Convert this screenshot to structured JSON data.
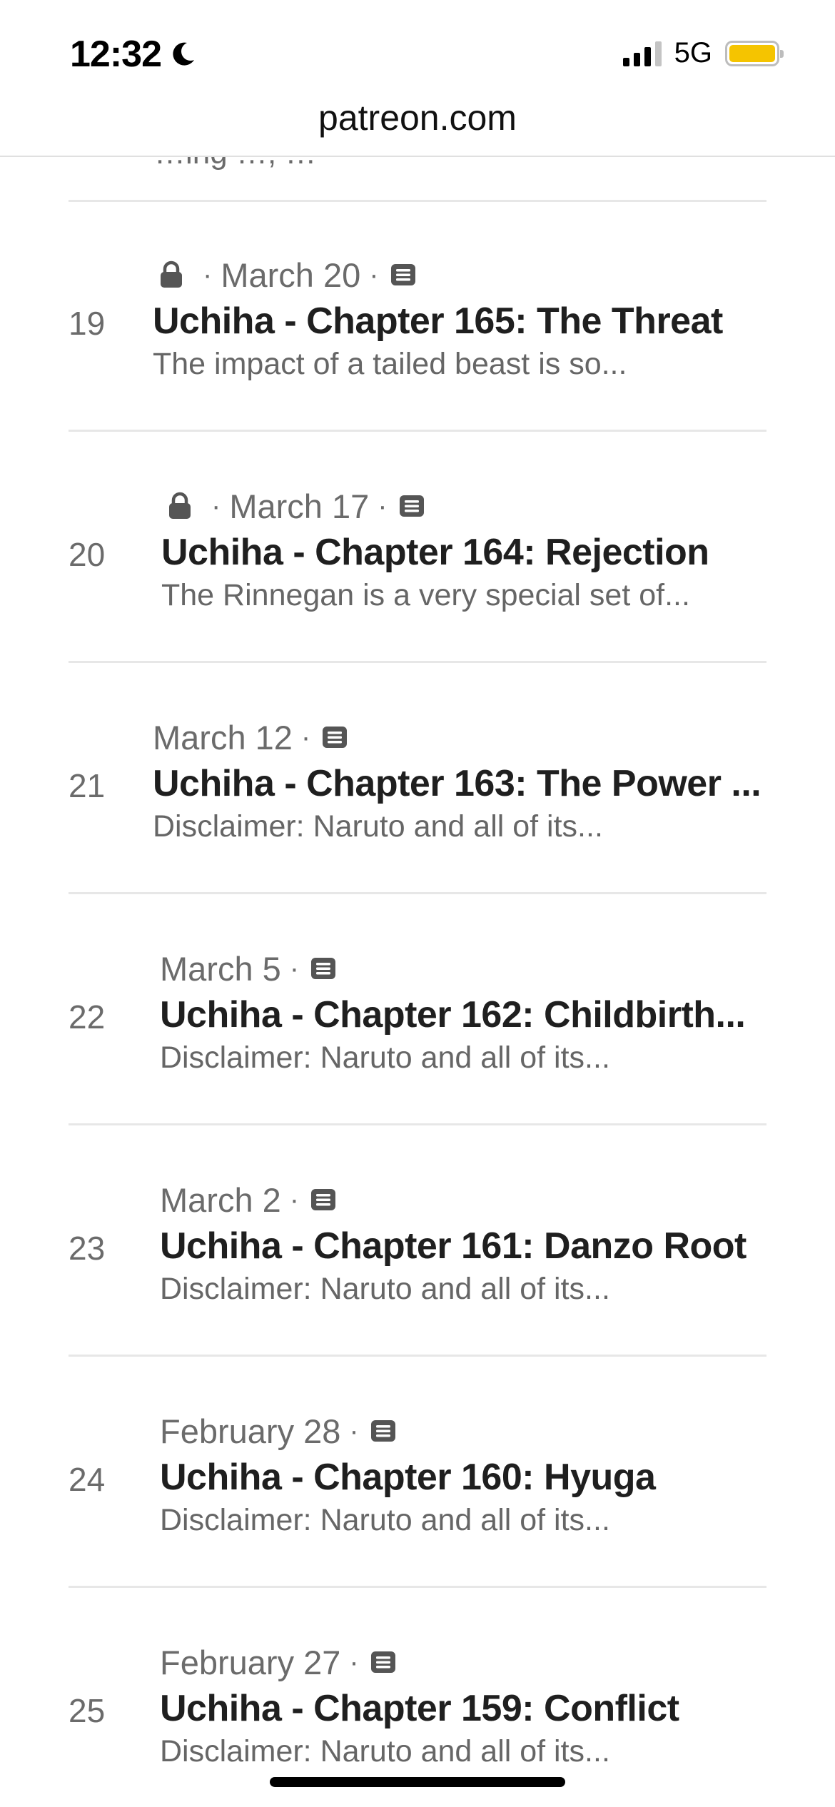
{
  "status_bar": {
    "time": "12:32",
    "network": "5G",
    "battery_color": "#f5c400"
  },
  "browser": {
    "url": "patreon.com"
  },
  "partial_row": {
    "excerpt": "…ing …, …"
  },
  "posts": [
    {
      "number": "19",
      "locked": true,
      "date": "March 20",
      "title": "Uchiha - Chapter 165: The Threat",
      "excerpt": "The impact of a tailed beast is so..."
    },
    {
      "number": "20",
      "locked": true,
      "date": "March 17",
      "title": "Uchiha - Chapter 164: Rejection",
      "excerpt": "The Rinnegan is a very special set of..."
    },
    {
      "number": "21",
      "locked": false,
      "date": "March 12",
      "title": "Uchiha - Chapter 163: The Power ...",
      "excerpt": "Disclaimer: Naruto and all of its..."
    },
    {
      "number": "22",
      "locked": false,
      "date": "March 5",
      "title": "Uchiha - Chapter 162: Childbirth...",
      "excerpt": "Disclaimer: Naruto and all of its..."
    },
    {
      "number": "23",
      "locked": false,
      "date": "March 2",
      "title": "Uchiha - Chapter 161: Danzo Root",
      "excerpt": "Disclaimer: Naruto and all of its..."
    },
    {
      "number": "24",
      "locked": false,
      "date": "February 28",
      "title": "Uchiha - Chapter 160: Hyuga",
      "excerpt": "Disclaimer: Naruto and all of its..."
    },
    {
      "number": "25",
      "locked": false,
      "date": "February 27",
      "title": "Uchiha - Chapter 159: Conflict",
      "excerpt": "Disclaimer: Naruto and all of its..."
    }
  ],
  "icons": {
    "lock": "lock-icon",
    "post_type": "text-post-icon",
    "moon": "moon-icon"
  }
}
